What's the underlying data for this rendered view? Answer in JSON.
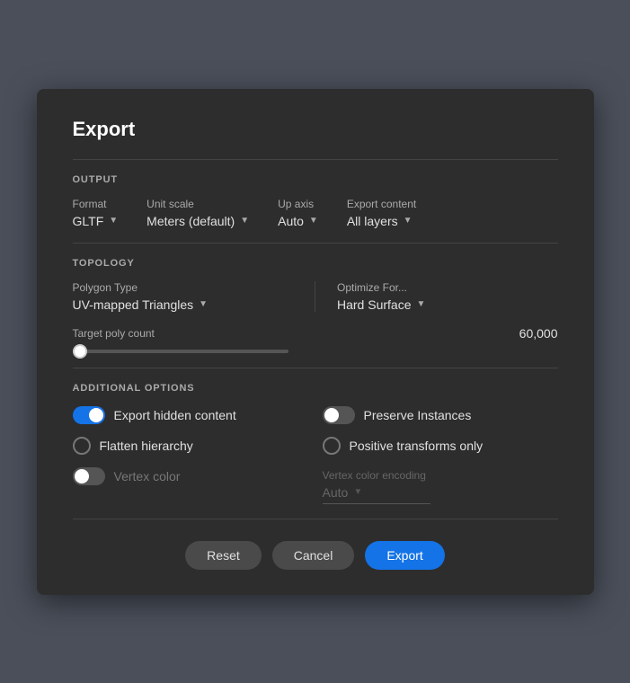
{
  "dialog": {
    "title": "Export"
  },
  "output": {
    "section_label": "OUTPUT",
    "format": {
      "label": "Format",
      "value": "GLTF"
    },
    "unit_scale": {
      "label": "Unit scale",
      "value": "Meters (default)"
    },
    "up_axis": {
      "label": "Up axis",
      "value": "Auto"
    },
    "export_content": {
      "label": "Export content",
      "value": "All layers"
    }
  },
  "topology": {
    "section_label": "TOPOLOGY",
    "polygon_type": {
      "label": "Polygon Type",
      "value": "UV-mapped Triangles"
    },
    "optimize_for": {
      "label": "Optimize For...",
      "value": "Hard Surface"
    },
    "target_poly_count": {
      "label": "Target poly count",
      "value": "60,000"
    }
  },
  "additional_options": {
    "section_label": "ADDITIONAL OPTIONS",
    "export_hidden": {
      "label": "Export hidden content",
      "enabled": true
    },
    "preserve_instances": {
      "label": "Preserve Instances",
      "enabled": false
    },
    "flatten_hierarchy": {
      "label": "Flatten hierarchy",
      "enabled": false
    },
    "positive_transforms": {
      "label": "Positive transforms only",
      "enabled": false
    },
    "vertex_color": {
      "label": "Vertex color",
      "enabled": false
    },
    "vertex_color_encoding": {
      "label": "Vertex color encoding",
      "value": "Auto"
    }
  },
  "footer": {
    "reset_label": "Reset",
    "cancel_label": "Cancel",
    "export_label": "Export"
  }
}
